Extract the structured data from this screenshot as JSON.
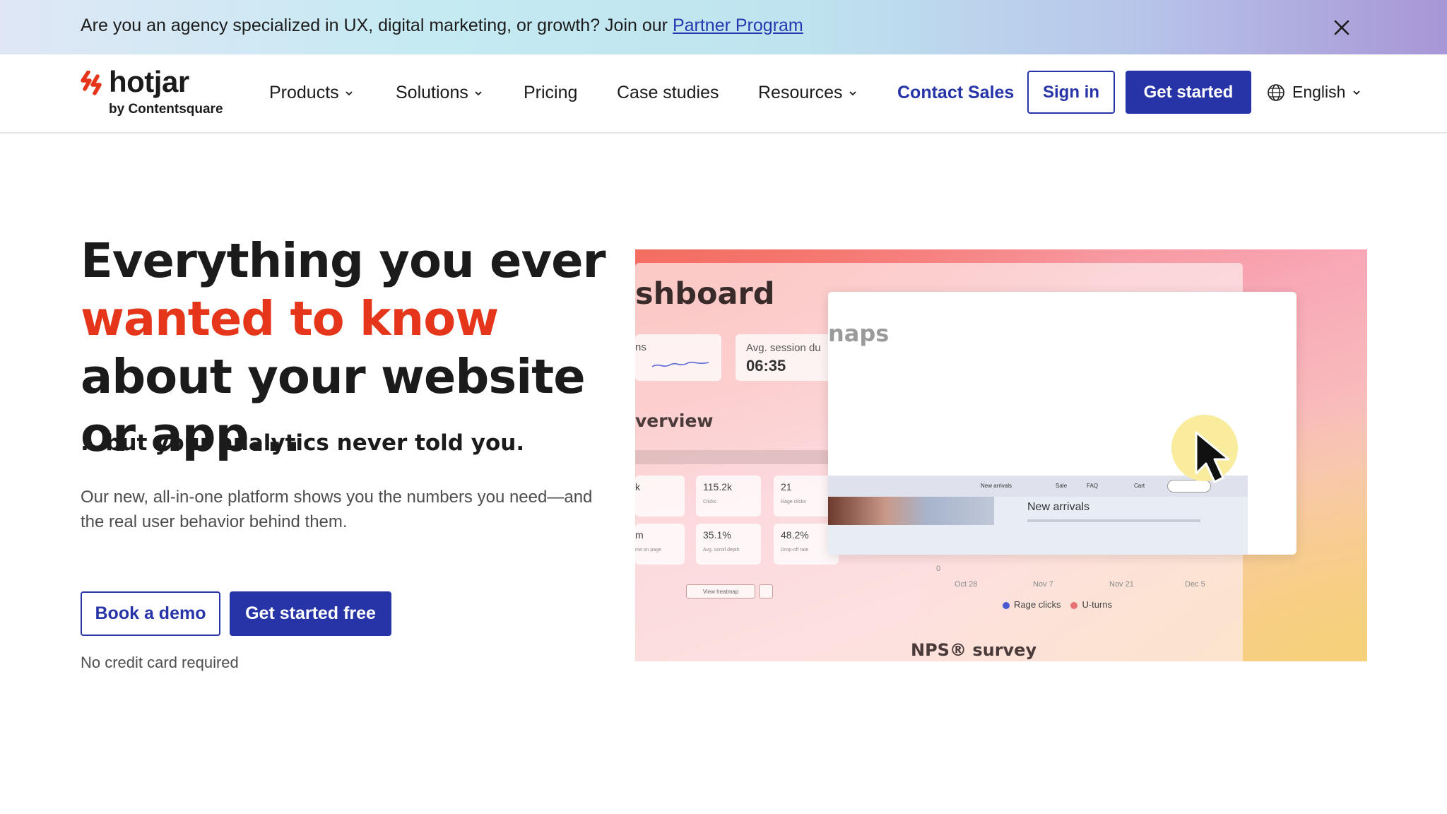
{
  "banner": {
    "text": "Are you an agency specialized in UX, digital marketing, or growth? Join our ",
    "link": "Partner Program",
    "close_icon": "close-icon"
  },
  "header": {
    "logo_word": "hotjar",
    "logo_sub": "by Contentsquare",
    "nav": {
      "products": "Products",
      "solutions": "Solutions",
      "pricing": "Pricing",
      "case_studies": "Case studies",
      "resources": "Resources"
    },
    "contact_sales": "Contact Sales",
    "sign_in": "Sign in",
    "get_started": "Get started",
    "language": "English"
  },
  "hero": {
    "headline_1": "Everything you ever",
    "headline_accent": "wanted to know",
    "headline_2": " about your website or app...",
    "subhead": "...but your analytics never told you.",
    "description": "Our new, all-in-one platform shows you the numbers you need—and the real user behavior behind them.",
    "book_demo": "Book a demo",
    "get_started_free": "Get started free",
    "no_credit_card": "No credit card required"
  },
  "screenshot": {
    "dashboard_title": "shboard",
    "card_1_label": "ns",
    "card_2_label": "Avg. session du",
    "card_2_value": "06:35",
    "overview_title": "verview",
    "heatmaps_title": "naps",
    "stats": [
      {
        "value": "k",
        "label": ""
      },
      {
        "value": "115.2k",
        "label": "Clicks"
      },
      {
        "value": "21",
        "label": "Rage clicks"
      },
      {
        "value": "m",
        "label": "me on page"
      },
      {
        "value": "35.1%",
        "label": "Avg. scroll depth"
      },
      {
        "value": "48.2%",
        "label": "Drop-off rate"
      }
    ],
    "view_heatmap": "View heatmap",
    "mock_nav": [
      "New arrivals",
      "Sale",
      "FAQ",
      "Cart"
    ],
    "mock_page_title": "New arrivals",
    "axis_zero": "0",
    "axis_dates": [
      "Oct 28",
      "Nov 7",
      "Nov 21",
      "Dec 5"
    ],
    "legend": [
      "Rage clicks",
      "U-turns"
    ],
    "legend_colors": [
      "#4a5bd0",
      "#e57373"
    ],
    "nps_title": "NPS® survey"
  },
  "colors": {
    "brand_blue": "#2634a8",
    "accent_red": "#e5361b"
  }
}
